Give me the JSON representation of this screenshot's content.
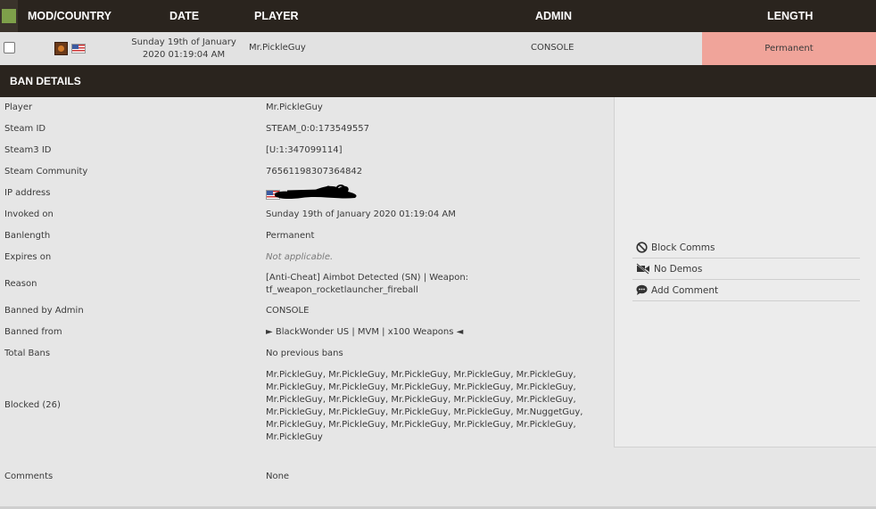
{
  "header": {
    "mod_country": "MOD/COUNTRY",
    "date": "DATE",
    "player": "PLAYER",
    "admin": "ADMIN",
    "length": "LENGTH"
  },
  "ban_row": {
    "date_line1": "Sunday 19th of January",
    "date_line2": "2020 01:19:04 AM",
    "player": "Mr.PickleGuy",
    "admin": "CONSOLE",
    "length": "Permanent",
    "length_color": "#f0a49a"
  },
  "ban_details": {
    "title": "BAN DETAILS",
    "rows": [
      {
        "label": "Player",
        "value": "Mr.PickleGuy"
      },
      {
        "label": "Steam ID",
        "value": "STEAM_0:0:173549557"
      },
      {
        "label": "Steam3 ID",
        "value": "[U:1:347099114]"
      },
      {
        "label": "Steam Community",
        "value": "76561198307364842"
      },
      {
        "label": "IP address",
        "value": ""
      },
      {
        "label": "Invoked on",
        "value": "Sunday 19th of January 2020 01:19:04 AM"
      },
      {
        "label": "Banlength",
        "value": "Permanent"
      },
      {
        "label": "Expires on",
        "value": "Not applicable."
      },
      {
        "label": "Reason",
        "value_line1": "[Anti-Cheat] Aimbot Detected (SN) | Weapon:",
        "value_line2": "tf_weapon_rocketlauncher_fireball"
      },
      {
        "label": "Banned by Admin",
        "value": "CONSOLE"
      },
      {
        "label": "Banned from",
        "value": "► BlackWonder US | MVM | x100 Weapons ◄"
      },
      {
        "label": "Total Bans",
        "value": "No previous bans"
      },
      {
        "label": "Blocked (26)",
        "lines": [
          "Mr.PickleGuy, Mr.PickleGuy, Mr.PickleGuy, Mr.PickleGuy, Mr.PickleGuy,",
          "Mr.PickleGuy, Mr.PickleGuy, Mr.PickleGuy, Mr.PickleGuy, Mr.PickleGuy,",
          "Mr.PickleGuy, Mr.PickleGuy, Mr.PickleGuy, Mr.PickleGuy, Mr.PickleGuy,",
          "Mr.PickleGuy, Mr.PickleGuy, Mr.PickleGuy, Mr.PickleGuy, Mr.NuggetGuy,",
          "Mr.PickleGuy, Mr.PickleGuy, Mr.PickleGuy, Mr.PickleGuy, Mr.PickleGuy,",
          "Mr.PickleGuy"
        ]
      },
      {
        "label": "Comments",
        "value": "None"
      }
    ]
  },
  "actions": [
    {
      "label": "Block Comms",
      "icon": "block-icon"
    },
    {
      "label": "No Demos",
      "icon": "video-off-icon"
    },
    {
      "label": "Add Comment",
      "icon": "comment-icon"
    }
  ]
}
